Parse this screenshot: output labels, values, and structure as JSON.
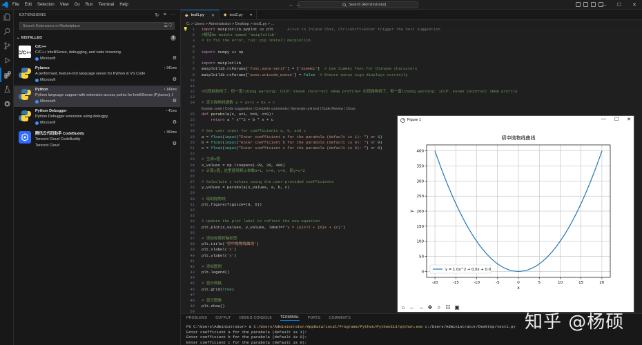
{
  "titlebar": {
    "menu": [
      "File",
      "Edit",
      "Selection",
      "View",
      "Go",
      "Run",
      "Terminal",
      "Help"
    ],
    "search": "Search [Administrator]"
  },
  "sidebar": {
    "title": "EXTENSIONS",
    "search_placeholder": "Search Extensions in Marketplace",
    "section": "INSTALLED",
    "count": "5",
    "extensions": [
      {
        "name": "C/C++",
        "desc": "C/C++ IntelliSense, debugging, and code browsing.",
        "publisher": "Microsoft",
        "time": ""
      },
      {
        "name": "Pylance",
        "desc": "A performant, feature-rich language server for Python in VS Code",
        "publisher": "Microsoft",
        "time": "341ms"
      },
      {
        "name": "Python",
        "desc": "Python language support with extension access points for IntelliSense (Pylance), D...",
        "publisher": "Microsoft",
        "time": "149ms"
      },
      {
        "name": "Python Debugger",
        "desc": "Python Debugger extension using debugpy.",
        "publisher": "Microsoft",
        "time": "41ms"
      },
      {
        "name": "腾讯云代码助手 CodeBuddy",
        "desc": "Tencent Cloud CodeBuddy",
        "publisher": "Tencent Cloud",
        "time": "350ms"
      }
    ]
  },
  "tabs": [
    {
      "label": "test1.py",
      "active": true
    },
    {
      "label": "test2.py",
      "active": false
    }
  ],
  "breadcrumb": "C: > Users > Administrator > Desktop > test1.py > ...",
  "code": [
    {
      "n": "1",
      "t": "import matplotlib.pyplot as plt      Alt+K to Inline Chat, Ctrl+Shift+Enter trigger the next suggestion"
    },
    {
      "n": "2",
      "t": "#报错No module named 'matplotlib'"
    },
    {
      "n": "3",
      "t": "# To fix the error, run: pip install matplotlib"
    },
    {
      "n": "4",
      "t": ""
    },
    {
      "n": "5",
      "t": "import numpy as np"
    },
    {
      "n": "6",
      "t": ""
    },
    {
      "n": "7",
      "t": "import matplotlib"
    },
    {
      "n": "8",
      "t": "matplotlib.rcParams['font.sans-serif'] = ['SimHei']  # Use SimHei font for Chinese characters"
    },
    {
      "n": "9",
      "t": "matplotlib.rcParams['axes.unicode_minus'] = False  # Ensure minus sign displays correctly"
    },
    {
      "n": "10",
      "t": ""
    },
    {
      "n": "11",
      "t": ""
    },
    {
      "n": "12",
      "t": "#出现抛物线了，但一直libpng warning: iCCP: known incorrect sRGB profile# 出现抛物线了，但一直libpng warning: iCCP: known incorrect sRGB profile"
    },
    {
      "n": "13",
      "t": ""
    },
    {
      "n": "14",
      "t": "# 定义抛物线函数 y = ax^2 + bx + c"
    },
    {
      "n": "",
      "t": "Explain code | Code suggestion | Complete comments | Generate unit test | Code Review | Close"
    },
    {
      "n": "15",
      "t": "def parabola(x, a=1, b=0, c=0):"
    },
    {
      "n": "16",
      "t": "    return a * x**2 + b * x + c"
    },
    {
      "n": "17",
      "t": ""
    },
    {
      "n": "18",
      "t": "# Get user input for coefficients a, b, and c"
    },
    {
      "n": "19",
      "t": "a = float(input(\"Enter coefficient a for the parabola (default is 1): \") or 1)"
    },
    {
      "n": "20",
      "t": "b = float(input(\"Enter coefficient b for the parabola (default is 0): \") or 0)"
    },
    {
      "n": "21",
      "t": "c = float(input(\"Enter coefficient c for the parabola (default is 0): \") or 0)"
    },
    {
      "n": "22",
      "t": ""
    },
    {
      "n": "23",
      "t": "# 生成x值"
    },
    {
      "n": "24",
      "t": "x_values = np.linspace(-20, 20, 400)"
    },
    {
      "n": "25",
      "t": "# 计算y值，这里使用默认参数a=1, b=0, c=0, 即y=x^2"
    },
    {
      "n": "26",
      "t": ""
    },
    {
      "n": "27",
      "t": "# Calculate y values using the user-provided coefficients"
    },
    {
      "n": "28",
      "t": "y_values = parabola(x_values, a, b, c)"
    },
    {
      "n": "29",
      "t": ""
    },
    {
      "n": "30",
      "t": "# 绘制抛物线"
    },
    {
      "n": "31",
      "t": "plt.figure(figsize=(8, 6))"
    },
    {
      "n": "32",
      "t": ""
    },
    {
      "n": "33",
      "t": ""
    },
    {
      "n": "34",
      "t": "# Update the plot label to reflect the new equation"
    },
    {
      "n": "35",
      "t": "plt.plot(x_values, y_values, label=f'y = {a}x^2 + {b}x + {c}')"
    },
    {
      "n": "36",
      "t": ""
    },
    {
      "n": "37",
      "t": "# 添加标题和轴标签"
    },
    {
      "n": "38",
      "t": "plt.title('初中抛物线曲线')"
    },
    {
      "n": "39",
      "t": "plt.xlabel('x')"
    },
    {
      "n": "40",
      "t": "plt.ylabel('y')"
    },
    {
      "n": "41",
      "t": ""
    },
    {
      "n": "42",
      "t": "# 添加图例"
    },
    {
      "n": "43",
      "t": "plt.legend()"
    },
    {
      "n": "44",
      "t": ""
    },
    {
      "n": "45",
      "t": "# 显示网格"
    },
    {
      "n": "46",
      "t": "plt.grid(True)"
    },
    {
      "n": "47",
      "t": ""
    },
    {
      "n": "48",
      "t": "# 显示图像"
    },
    {
      "n": "49",
      "t": "plt.show()"
    },
    {
      "n": "50",
      "t": ""
    }
  ],
  "panel": {
    "tabs": [
      "PROBLEMS",
      "OUTPUT",
      "DEBUG CONSOLE",
      "TERMINAL",
      "PORTS",
      "COMMENTS"
    ],
    "active_tab": "TERMINAL",
    "prompt": "PS C:\\Users\\Administrator> & ",
    "cmd_path": "C:/Users/Administrator/AppData/Local/Programs/Python/Python313/python.exe",
    "cmd_arg": " c:/Users/Administrator/Desktop/test1.py",
    "lines": [
      "Enter coefficient a for the parabola (default is 1):",
      "Enter coefficient b for the parabola (default is 0):",
      "Enter coefficient c for the parabola (default is 0):"
    ]
  },
  "figure": {
    "window_title": "Figure 1"
  },
  "chart_data": {
    "type": "line",
    "title": "初中抛物线曲线",
    "xlabel": "x",
    "ylabel": "y",
    "xlim": [
      -22,
      22
    ],
    "ylim": [
      -20,
      420
    ],
    "xticks": [
      -20,
      -15,
      -10,
      -5,
      0,
      5,
      10,
      15,
      20
    ],
    "yticks": [
      0,
      50,
      100,
      150,
      200,
      250,
      300,
      350,
      400
    ],
    "grid": true,
    "legend_position": "lower-left",
    "series": [
      {
        "name": "y = 1.0x^2 + 0.0x + 0.0",
        "function": "x^2",
        "x_range": [
          -20,
          20
        ],
        "color": "#1f77b4"
      }
    ]
  },
  "watermark": "知乎 @杨硕"
}
